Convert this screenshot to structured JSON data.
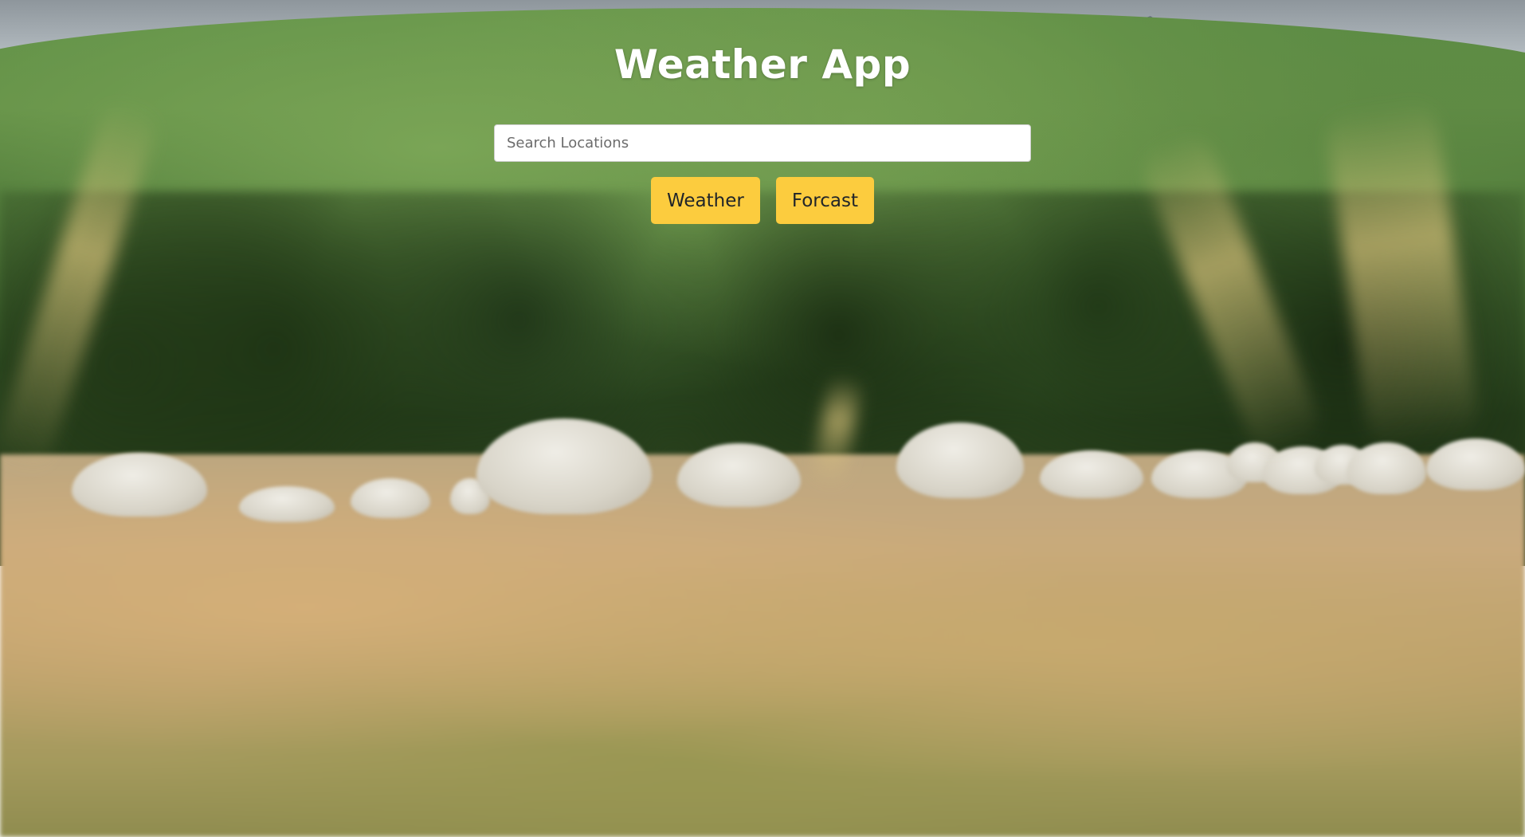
{
  "app": {
    "title": "Weather App"
  },
  "search": {
    "placeholder": "Search Locations",
    "value": ""
  },
  "buttons": {
    "weather_label": "Weather",
    "forecast_label": "Forcast"
  },
  "colors": {
    "button_background": "#fccc3e",
    "title_text": "#ffffff",
    "button_text": "#212529"
  },
  "background": {
    "image_subject": "sheep-grazing-in-grass-field"
  }
}
